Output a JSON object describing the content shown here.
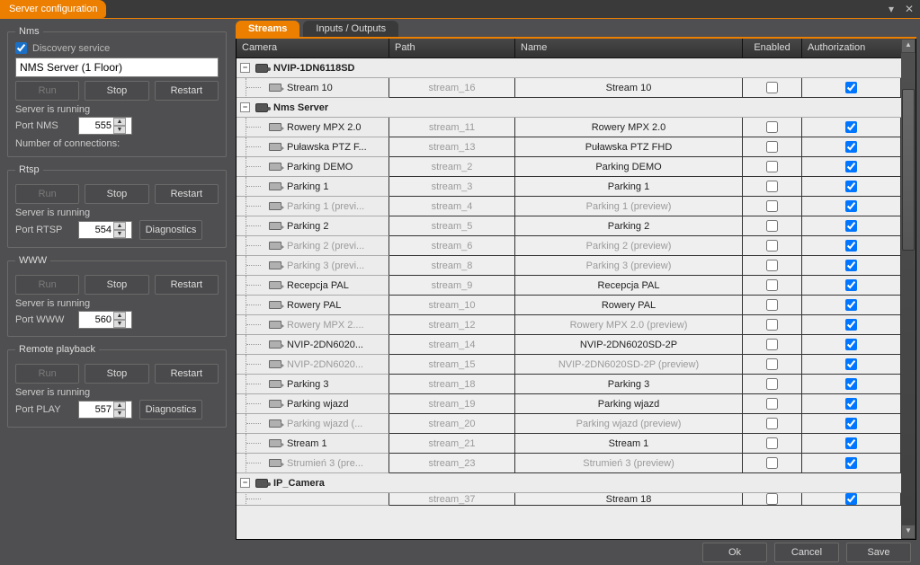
{
  "window": {
    "title": "Server configuration"
  },
  "tabs": {
    "streams": "Streams",
    "io": "Inputs / Outputs"
  },
  "headers": {
    "camera": "Camera",
    "path": "Path",
    "name": "Name",
    "enabled": "Enabled",
    "auth": "Authorization"
  },
  "left": {
    "nms": {
      "legend": "Nms",
      "discovery_label": "Discovery service",
      "discovery_checked": true,
      "name_value": "NMS Server (1 Floor)",
      "run": "Run",
      "stop": "Stop",
      "restart": "Restart",
      "status": "Server is running",
      "port_label": "Port NMS",
      "port_value": "555",
      "conn_label": "Number of connections:"
    },
    "rtsp": {
      "legend": "Rtsp",
      "run": "Run",
      "stop": "Stop",
      "restart": "Restart",
      "status": "Server is running",
      "port_label": "Port RTSP",
      "port_value": "554",
      "diag": "Diagnostics"
    },
    "www": {
      "legend": "WWW",
      "run": "Run",
      "stop": "Stop",
      "restart": "Restart",
      "status": "Server is running",
      "port_label": "Port WWW",
      "port_value": "560"
    },
    "play": {
      "legend": "Remote playback",
      "run": "Run",
      "stop": "Stop",
      "restart": "Restart",
      "status": "Server is running",
      "port_label": "Port PLAY",
      "port_value": "557",
      "diag": "Diagnostics"
    }
  },
  "footer": {
    "ok": "Ok",
    "cancel": "Cancel",
    "save": "Save"
  },
  "tree": {
    "groups": [
      {
        "label": "NVIP-1DN6118SD",
        "streams": [
          {
            "camera": "Stream 10",
            "path": "stream_16",
            "name": "Stream 10",
            "enabled": false,
            "auth": true,
            "dim": false
          }
        ]
      },
      {
        "label": "Nms Server",
        "streams": [
          {
            "camera": "Rowery MPX 2.0",
            "path": "stream_11",
            "name": "Rowery MPX 2.0",
            "enabled": false,
            "auth": true,
            "dim": false
          },
          {
            "camera": "Puławska PTZ F...",
            "path": "stream_13",
            "name": "Puławska PTZ FHD",
            "enabled": false,
            "auth": true,
            "dim": false
          },
          {
            "camera": "Parking DEMO",
            "path": "stream_2",
            "name": "Parking DEMO",
            "enabled": false,
            "auth": true,
            "dim": false
          },
          {
            "camera": "Parking 1",
            "path": "stream_3",
            "name": "Parking 1",
            "enabled": false,
            "auth": true,
            "dim": false
          },
          {
            "camera": "Parking 1 (previ...",
            "path": "stream_4",
            "name": "Parking 1 (preview)",
            "enabled": false,
            "auth": true,
            "dim": true
          },
          {
            "camera": "Parking 2",
            "path": "stream_5",
            "name": "Parking 2",
            "enabled": false,
            "auth": true,
            "dim": false
          },
          {
            "camera": "Parking 2 (previ...",
            "path": "stream_6",
            "name": "Parking 2 (preview)",
            "enabled": false,
            "auth": true,
            "dim": true
          },
          {
            "camera": "Parking 3 (previ...",
            "path": "stream_8",
            "name": "Parking 3 (preview)",
            "enabled": false,
            "auth": true,
            "dim": true
          },
          {
            "camera": "Recepcja PAL",
            "path": "stream_9",
            "name": "Recepcja PAL",
            "enabled": false,
            "auth": true,
            "dim": false
          },
          {
            "camera": "Rowery PAL",
            "path": "stream_10",
            "name": "Rowery PAL",
            "enabled": false,
            "auth": true,
            "dim": false
          },
          {
            "camera": "Rowery MPX 2....",
            "path": "stream_12",
            "name": "Rowery MPX 2.0 (preview)",
            "enabled": false,
            "auth": true,
            "dim": true
          },
          {
            "camera": "NVIP-2DN6020...",
            "path": "stream_14",
            "name": "NVIP-2DN6020SD-2P",
            "enabled": false,
            "auth": true,
            "dim": false
          },
          {
            "camera": "NVIP-2DN6020...",
            "path": "stream_15",
            "name": "NVIP-2DN6020SD-2P (preview)",
            "enabled": false,
            "auth": true,
            "dim": true
          },
          {
            "camera": "Parking 3",
            "path": "stream_18",
            "name": "Parking 3",
            "enabled": false,
            "auth": true,
            "dim": false
          },
          {
            "camera": "Parking wjazd",
            "path": "stream_19",
            "name": "Parking wjazd",
            "enabled": false,
            "auth": true,
            "dim": false
          },
          {
            "camera": "Parking wjazd (...",
            "path": "stream_20",
            "name": "Parking wjazd (preview)",
            "enabled": false,
            "auth": true,
            "dim": true
          },
          {
            "camera": "Stream 1",
            "path": "stream_21",
            "name": "Stream 1",
            "enabled": false,
            "auth": true,
            "dim": false
          },
          {
            "camera": "Strumień 3 (pre...",
            "path": "stream_23",
            "name": "Strumień 3 (preview)",
            "enabled": false,
            "auth": true,
            "dim": true
          }
        ]
      },
      {
        "label": "IP_Camera",
        "streams_partial": {
          "path": "stream_37",
          "name": "Stream 18",
          "enabled": false,
          "auth": true
        }
      }
    ]
  }
}
